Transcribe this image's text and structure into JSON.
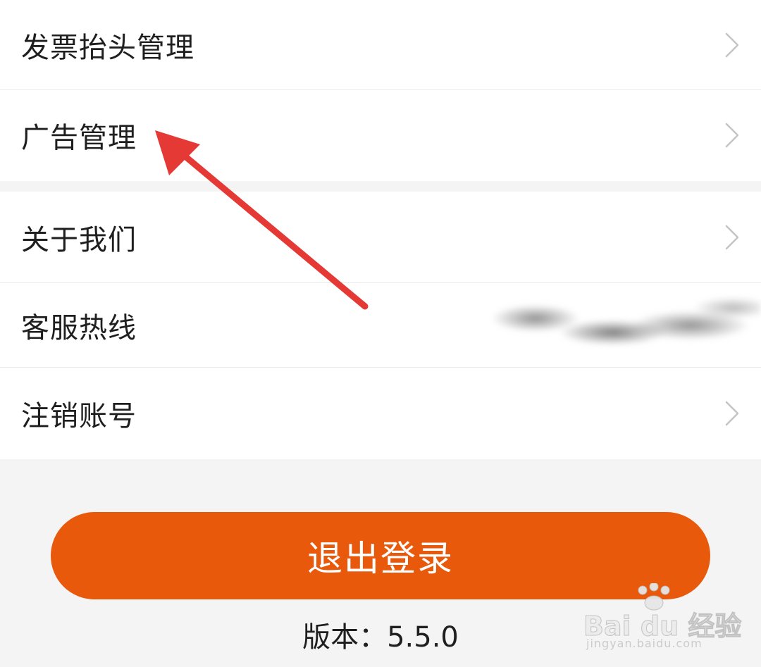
{
  "menu_group_1": {
    "items": [
      {
        "label": "发票抬头管理"
      },
      {
        "label": "广告管理"
      }
    ]
  },
  "menu_group_2": {
    "items": [
      {
        "label": "关于我们"
      },
      {
        "label": "客服热线"
      },
      {
        "label": "注销账号"
      }
    ]
  },
  "logout_button": {
    "label": "退出登录"
  },
  "version": {
    "text": "版本：5.5.0"
  },
  "watermark": {
    "brand": "Bai du 经验",
    "url": "jingyan.baidu.com"
  },
  "colors": {
    "accent": "#e8590c",
    "annotation_arrow": "#e53935",
    "background": "#f4f4f4",
    "card": "#ffffff",
    "text": "#1f1f1f",
    "chevron": "#c4c4c4"
  },
  "icons": {
    "row_chevron": "chevron-right-icon",
    "annotation": "arrow-icon",
    "watermark_logo": "paw-icon"
  }
}
